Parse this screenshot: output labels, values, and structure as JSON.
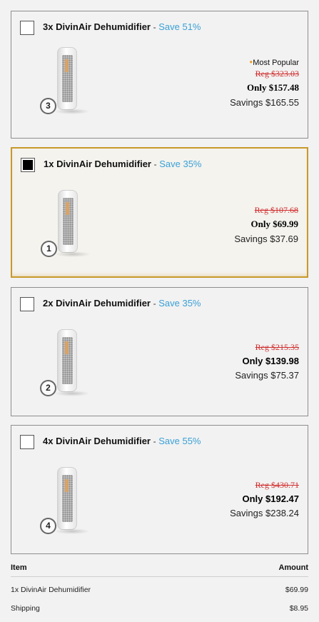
{
  "offers": [
    {
      "title": "3x DivinAir Dehumidifier",
      "dash": "-",
      "save": "Save 51%",
      "qty": "3",
      "popular": "Most Popular",
      "reg": "Reg $323.03",
      "only": "Only $157.48",
      "savings": "Savings $165.55",
      "checked": false
    },
    {
      "title": "1x DivinAir Dehumidifier",
      "dash": "-",
      "save": "Save 35%",
      "qty": "1",
      "reg": "Reg $107.68",
      "only": "Only $69.99",
      "savings": "Savings $37.69",
      "checked": true
    },
    {
      "title": "2x DivinAir Dehumidifier",
      "dash": "-",
      "save": "Save 35%",
      "qty": "2",
      "reg": "Reg $215.35",
      "only": "Only $139.98",
      "savings": "Savings $75.37",
      "checked": false
    },
    {
      "title": "4x DivinAir Dehumidifier",
      "dash": "-",
      "save": "Save 55%",
      "qty": "4",
      "reg": "Reg $430.71",
      "only": "Only $192.47",
      "savings": "Savings $238.24",
      "checked": false
    }
  ],
  "summary": {
    "item_header": "Item",
    "amount_header": "Amount",
    "rows": [
      {
        "item": "1x DivinAir Dehumidifier",
        "amount": "$69.99"
      },
      {
        "item": "Shipping",
        "amount": "$8.95"
      }
    ]
  },
  "colors": {
    "accent_blue": "#3aa0d6",
    "reg_red": "#d12f2f",
    "selected_border": "#c8992a",
    "popular_star": "#f0a030"
  }
}
